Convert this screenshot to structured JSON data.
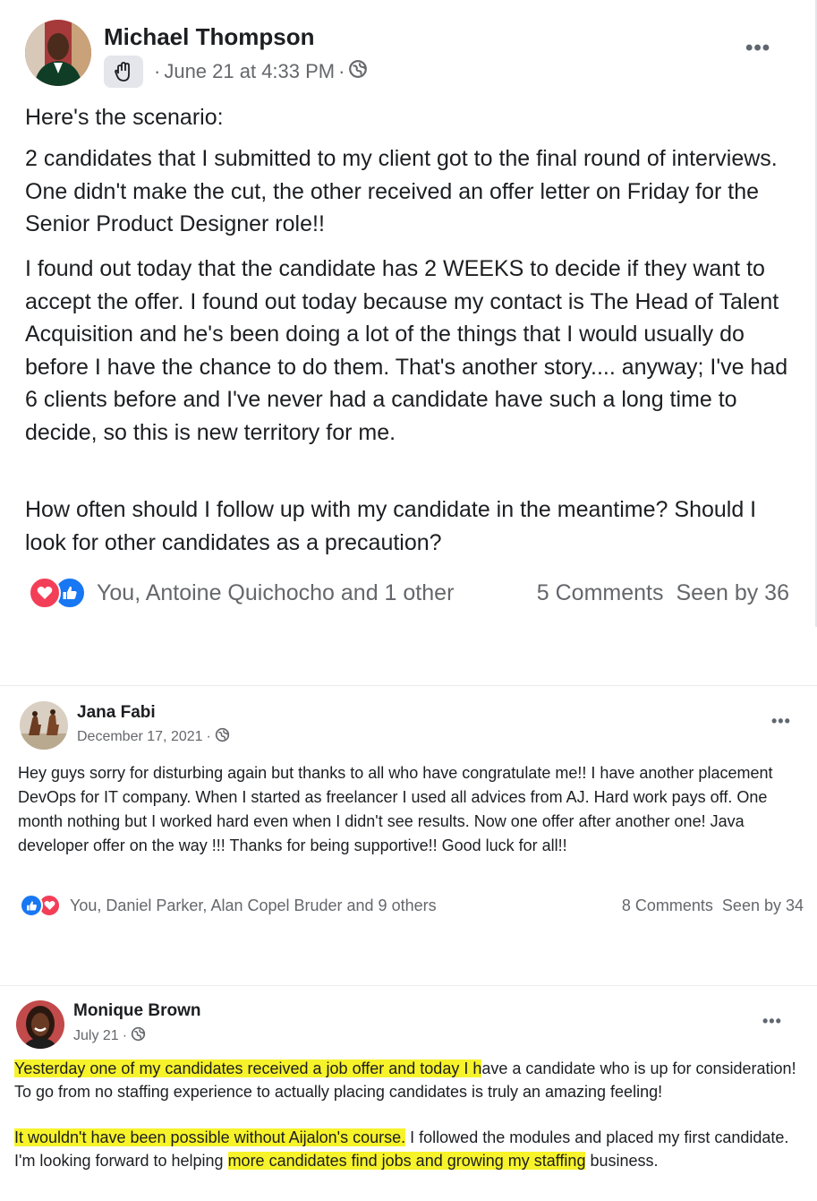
{
  "post1": {
    "author": "Michael Thompson",
    "timestamp": "June 21 at 4:33 PM",
    "dot": "·",
    "paragraphs": [
      "Here's the scenario:",
      "2 candidates that I submitted to my client got to the final round of interviews. One didn't make the cut, the other received an offer letter on Friday for the Senior Product Designer role!!",
      "I found out today that the candidate has 2 WEEKS to decide if they want to accept the offer. I found out today because my contact is The Head of Talent Acquisition and he's been doing a lot of the things that I would usually do before I have the chance to do them. That's another story.... anyway; I've had 6 clients before and I've never had a candidate have such a long time to decide, so this is new territory for me.",
      "How often should I follow up with my candidate in the meantime? Should I look for other candidates as a precaution?"
    ],
    "reactions_text": "You, Antoine Quichocho and 1 other",
    "comments": "5 Comments",
    "seen_by": "Seen by 36"
  },
  "post2": {
    "author": "Jana Fabi",
    "timestamp": "December 17, 2021",
    "dot": "·",
    "body": "Hey guys sorry for disturbing again but thanks to all who have congratulate me!! I have another placement DevOps for IT company. When I started as freelancer I used all advices from AJ. Hard work pays off. One month nothing but I worked hard even when I didn't see results. Now one offer after another one! Java developer offer on the way !!! Thanks for being supportive!! Good luck for all!!",
    "reactions_text": "You, Daniel Parker, Alan Copel Bruder and 9 others",
    "comments": "8 Comments",
    "seen_by": "Seen by 34"
  },
  "post3": {
    "author": "Monique Brown",
    "timestamp": "July 21",
    "dot": "·",
    "p1_highlight": "Yesterday one of my candidates received a job offer and today I h",
    "p1_rest": "ave a candidate who is up for consideration!  To go from no staffing experience to actually placing candidates is truly an amazing feeling!",
    "p2_highlight": "It wouldn't have been possible without Aijalon's course.",
    "p2_mid": " I followed the modules and placed my first candidate. I'm looking forward to helping ",
    "p2_highlight2": "more candidates find jobs and growing my staffing",
    "p2_end": " business."
  },
  "icons": {
    "more": "•••",
    "like": "like-icon",
    "love": "love-icon",
    "globe": "globe-icon",
    "badge": "wave-badge-icon"
  },
  "colors": {
    "like_blue": "#1877f2",
    "love_red": "#f33e58",
    "highlight": "#f7f32a",
    "meta_gray": "#65676b"
  }
}
